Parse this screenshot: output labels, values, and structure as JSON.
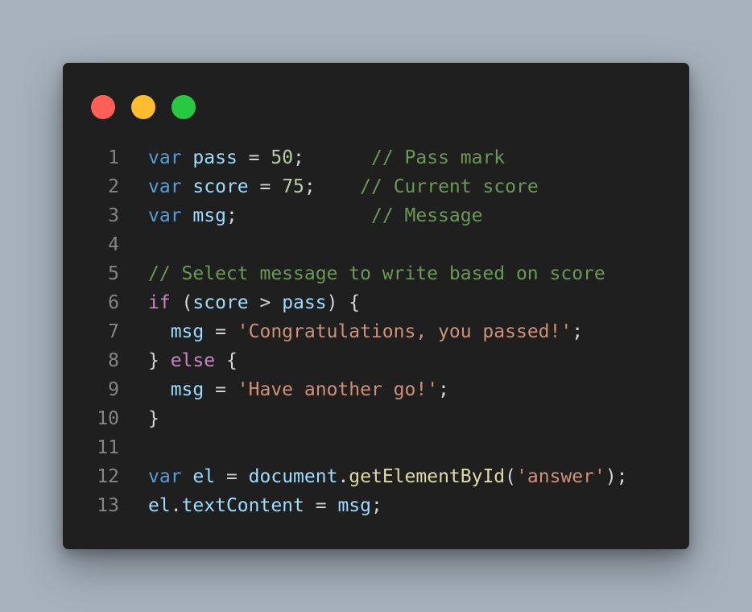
{
  "window": {
    "controls": [
      {
        "name": "close",
        "color": "#ff5f57"
      },
      {
        "name": "minimize",
        "color": "#febc2e"
      },
      {
        "name": "maximize",
        "color": "#28c840"
      }
    ]
  },
  "code": {
    "language": "javascript",
    "lines": [
      {
        "n": "1",
        "tokens": [
          {
            "t": "var",
            "c": "kw"
          },
          {
            "t": " ",
            "c": "pl"
          },
          {
            "t": "pass",
            "c": "id"
          },
          {
            "t": " = ",
            "c": "pl"
          },
          {
            "t": "50",
            "c": "num"
          },
          {
            "t": ";      ",
            "c": "pl"
          },
          {
            "t": "// Pass mark",
            "c": "cm"
          }
        ]
      },
      {
        "n": "2",
        "tokens": [
          {
            "t": "var",
            "c": "kw"
          },
          {
            "t": " ",
            "c": "pl"
          },
          {
            "t": "score",
            "c": "id"
          },
          {
            "t": " = ",
            "c": "pl"
          },
          {
            "t": "75",
            "c": "num"
          },
          {
            "t": ";    ",
            "c": "pl"
          },
          {
            "t": "// Current score",
            "c": "cm"
          }
        ]
      },
      {
        "n": "3",
        "tokens": [
          {
            "t": "var",
            "c": "kw"
          },
          {
            "t": " ",
            "c": "pl"
          },
          {
            "t": "msg",
            "c": "id"
          },
          {
            "t": ";            ",
            "c": "pl"
          },
          {
            "t": "// Message",
            "c": "cm"
          }
        ]
      },
      {
        "n": "4",
        "tokens": []
      },
      {
        "n": "5",
        "tokens": [
          {
            "t": "// Select message to write based on score",
            "c": "cm"
          }
        ]
      },
      {
        "n": "6",
        "tokens": [
          {
            "t": "if",
            "c": "ctl"
          },
          {
            "t": " (",
            "c": "pl"
          },
          {
            "t": "score",
            "c": "id"
          },
          {
            "t": " > ",
            "c": "pl"
          },
          {
            "t": "pass",
            "c": "id"
          },
          {
            "t": ") {",
            "c": "pl"
          }
        ]
      },
      {
        "n": "7",
        "tokens": [
          {
            "t": "  ",
            "c": "pl"
          },
          {
            "t": "msg",
            "c": "id"
          },
          {
            "t": " = ",
            "c": "pl"
          },
          {
            "t": "'Congratulations, you passed!'",
            "c": "str"
          },
          {
            "t": ";",
            "c": "pl"
          }
        ]
      },
      {
        "n": "8",
        "tokens": [
          {
            "t": "} ",
            "c": "pl"
          },
          {
            "t": "else",
            "c": "ctl"
          },
          {
            "t": " {",
            "c": "pl"
          }
        ]
      },
      {
        "n": "9",
        "tokens": [
          {
            "t": "  ",
            "c": "pl"
          },
          {
            "t": "msg",
            "c": "id"
          },
          {
            "t": " = ",
            "c": "pl"
          },
          {
            "t": "'Have another go!'",
            "c": "str"
          },
          {
            "t": ";",
            "c": "pl"
          }
        ]
      },
      {
        "n": "10",
        "tokens": [
          {
            "t": "}",
            "c": "pl"
          }
        ]
      },
      {
        "n": "11",
        "tokens": []
      },
      {
        "n": "12",
        "tokens": [
          {
            "t": "var",
            "c": "kw"
          },
          {
            "t": " ",
            "c": "pl"
          },
          {
            "t": "el",
            "c": "id"
          },
          {
            "t": " = ",
            "c": "pl"
          },
          {
            "t": "document",
            "c": "id"
          },
          {
            "t": ".",
            "c": "pl"
          },
          {
            "t": "getElementById",
            "c": "fn"
          },
          {
            "t": "(",
            "c": "pl"
          },
          {
            "t": "'answer'",
            "c": "str"
          },
          {
            "t": ");",
            "c": "pl"
          }
        ]
      },
      {
        "n": "13",
        "tokens": [
          {
            "t": "el",
            "c": "id"
          },
          {
            "t": ".",
            "c": "pl"
          },
          {
            "t": "textContent",
            "c": "id"
          },
          {
            "t": " = ",
            "c": "pl"
          },
          {
            "t": "msg",
            "c": "id"
          },
          {
            "t": ";",
            "c": "pl"
          }
        ]
      }
    ]
  }
}
